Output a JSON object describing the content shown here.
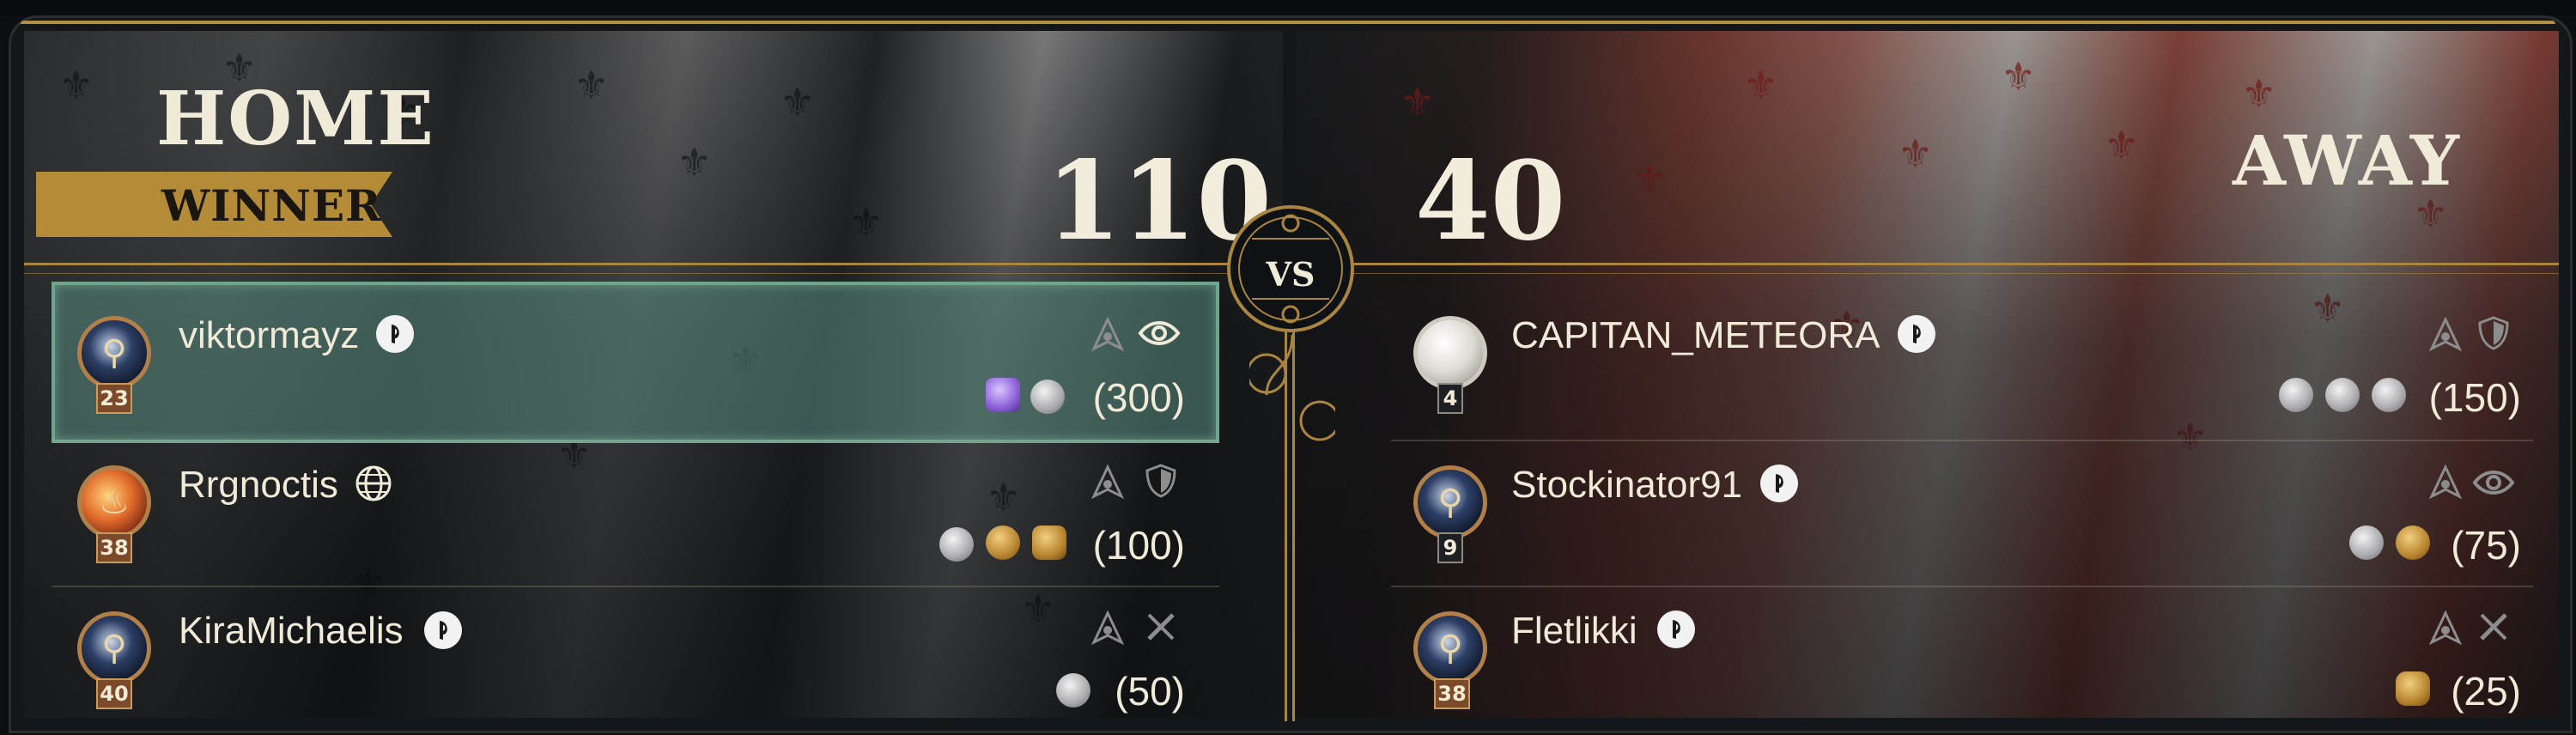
{
  "home": {
    "label": "HOME",
    "ribbon": "WINNER",
    "score": "110",
    "players": [
      {
        "name": "viktormayz",
        "level": "23",
        "platform": "playstation-icon",
        "roles": [
          "archer-icon",
          "eye-icon"
        ],
        "medals": [
          "purple",
          "silver"
        ],
        "points": "(300)",
        "highlighted": true
      },
      {
        "name": "Rrgnoctis",
        "level": "38",
        "platform": "globe-icon",
        "roles": [
          "archer-icon",
          "shield-icon"
        ],
        "medals": [
          "silver",
          "gold",
          "gold"
        ],
        "points": "(100)",
        "highlighted": false
      },
      {
        "name": "KiraMichaelis",
        "level": "40",
        "platform": "playstation-icon",
        "roles": [
          "archer-icon",
          "sword-icon"
        ],
        "medals": [
          "silver"
        ],
        "points": "(50)",
        "highlighted": false
      }
    ]
  },
  "away": {
    "label": "AWAY",
    "score": "40",
    "players": [
      {
        "name": "CAPITAN_METEORA",
        "level": "4",
        "platform": "playstation-icon",
        "roles": [
          "archer-icon",
          "shield-icon"
        ],
        "medals": [
          "silver",
          "silver",
          "silver"
        ],
        "points": "(150)"
      },
      {
        "name": "Stockinator91",
        "level": "9",
        "platform": "playstation-icon",
        "roles": [
          "archer-icon",
          "eye-icon"
        ],
        "medals": [
          "silver",
          "gold"
        ],
        "points": "(75)"
      },
      {
        "name": "Fletlikki",
        "level": "38",
        "platform": "playstation-icon",
        "roles": [
          "archer-icon",
          "sword-icon"
        ],
        "medals": [
          "gold"
        ],
        "points": "(25)"
      }
    ]
  },
  "versus": "VS",
  "colors": {
    "gold_accent": "#b38e45",
    "highlight_border": "#6fa58e",
    "text": "#f0ead8"
  }
}
